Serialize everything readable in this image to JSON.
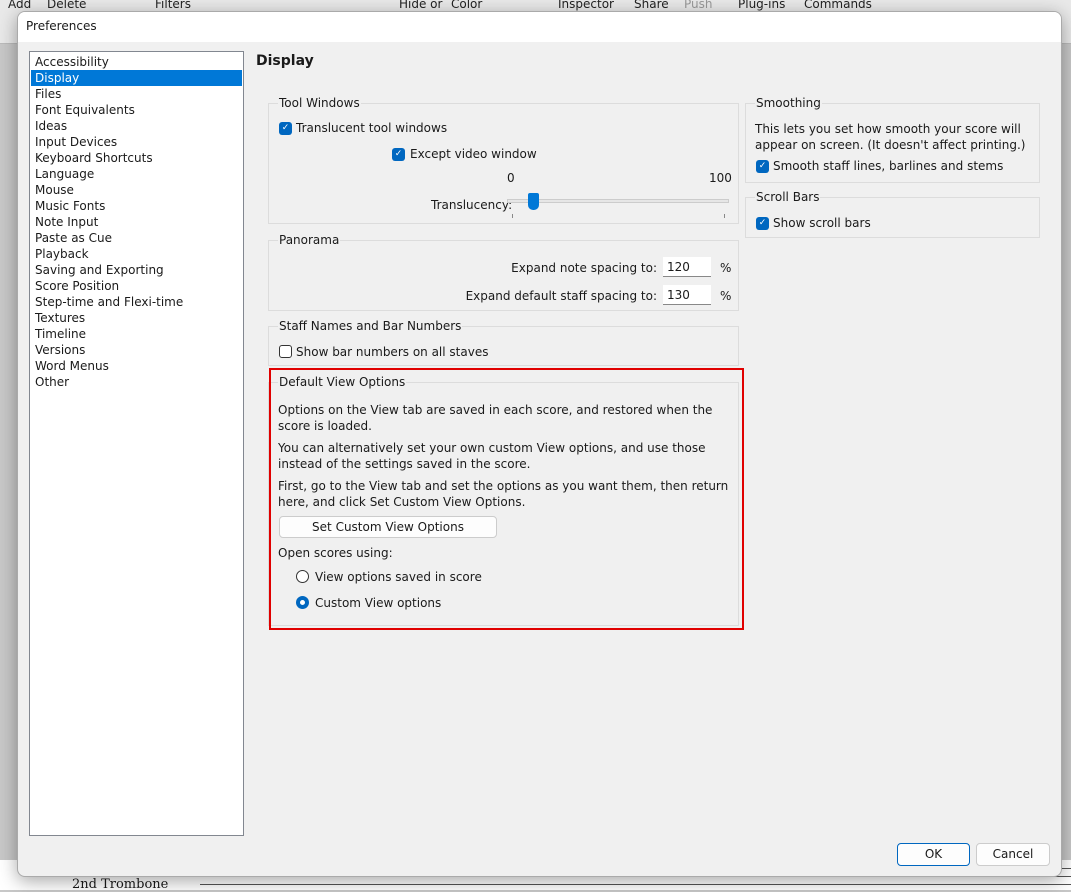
{
  "background_app": {
    "toolbar": [
      "Add",
      "Delete",
      "Filters",
      "Hide or",
      "Color",
      "Inspector",
      "Share",
      "Push",
      "Plug-ins",
      "Commands"
    ],
    "score_instrument": "2nd Trombone"
  },
  "dialog": {
    "title": "Preferences",
    "categories": [
      "Accessibility",
      "Display",
      "Files",
      "Font Equivalents",
      "Ideas",
      "Input Devices",
      "Keyboard Shortcuts",
      "Language",
      "Mouse",
      "Music Fonts",
      "Note Input",
      "Paste as Cue",
      "Playback",
      "Saving and Exporting",
      "Score Position",
      "Step-time and Flexi-time",
      "Textures",
      "Timeline",
      "Versions",
      "Word Menus",
      "Other"
    ],
    "selected_category": "Display",
    "heading": "Display",
    "tool_windows": {
      "title": "Tool Windows",
      "translucent": {
        "label": "Translucent tool windows",
        "checked": true
      },
      "except_video": {
        "label": "Except video window",
        "checked": true
      },
      "slider_min": "0",
      "slider_max": "100",
      "slider_label": "Translucency:",
      "slider_value": 10
    },
    "panorama": {
      "title": "Panorama",
      "note_label": "Expand note spacing to:",
      "note_value": "120",
      "staff_label": "Expand default staff spacing to:",
      "staff_value": "130",
      "unit": "%"
    },
    "staff_names": {
      "title": "Staff Names and Bar Numbers",
      "show_bar_numbers": {
        "label": "Show bar numbers on all staves",
        "checked": false
      }
    },
    "default_view": {
      "title": "Default View Options",
      "p1": "Options on the View tab are saved in each score, and restored when the score is loaded.",
      "p2": "You can alternatively set your own custom View options, and use those instead of the settings saved in the score.",
      "p3": "First, go to the View tab and set the options as you want them, then return here, and click Set Custom View Options.",
      "set_button": "Set Custom View Options",
      "open_label": "Open scores using:",
      "radio_saved": "View options saved in score",
      "radio_custom": "Custom View options",
      "selected": "Custom View options"
    },
    "smoothing": {
      "title": "Smoothing",
      "desc": "This lets you set how smooth your score will appear on screen. (It doesn't affect printing.)",
      "smooth": {
        "label": "Smooth staff lines, barlines and stems",
        "checked": true
      }
    },
    "scroll_bars": {
      "title": "Scroll Bars",
      "show": {
        "label": "Show scroll bars",
        "checked": true
      }
    },
    "ok": "OK",
    "cancel": "Cancel",
    "colors": {
      "accent": "#0067c0",
      "highlight": "#e00000"
    }
  }
}
